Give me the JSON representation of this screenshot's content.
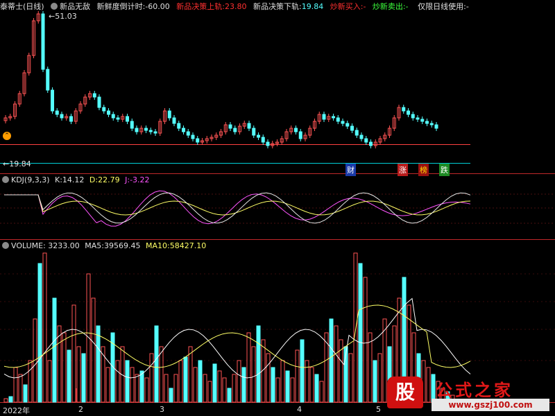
{
  "header": {
    "stock_name": "泰蒂士(日线)",
    "indicator_name": "新品无敌",
    "countdown_label": "新鲜度倒计时:",
    "countdown_value": "-60.00",
    "upper_label": "新品决策上轨:",
    "upper_value": "23.80",
    "lower_label": "新品决策下轨:",
    "lower_value": "19.84",
    "buy_label": "炒新买入:",
    "buy_value": "-",
    "sell_label": "炒新卖出:",
    "sell_value": "-",
    "daily_only_label": "仅限日线使用:",
    "daily_only_value": "-"
  },
  "price_panel": {
    "high_label": "51.03",
    "low_label": "19.84",
    "tags": {
      "cai": "财",
      "zhang": "涨",
      "bang": "榜",
      "die": "跌"
    }
  },
  "kdj_panel": {
    "title": "KDJ(9,3,3)",
    "k_label": "K:",
    "k_value": "14.12",
    "d_label": "D:",
    "d_value": "22.79",
    "j_label": "J:",
    "j_value": "-3.22"
  },
  "volume_panel": {
    "title": "VOLUME:",
    "volume_value": "3233.00",
    "ma5_label": "MA5:",
    "ma5_value": "39569.45",
    "ma10_label": "MA10:",
    "ma10_value": "58427.10"
  },
  "x_axis": [
    "2022年",
    "2",
    "3",
    "4",
    "5"
  ],
  "watermark": {
    "badge": "股",
    "title": "公式之家",
    "url": "www.gszj100.com"
  },
  "colors": {
    "up": "#ff5454",
    "down": "#54ffff",
    "kline": "#e8e8e8",
    "dline": "#ffff66",
    "jline": "#ff55ff",
    "cyan": "#00d0d8",
    "grid": "#c0282a"
  },
  "chart_data": {
    "type": "bar",
    "series_kind": "candlestick + volume",
    "price_high": 51.03,
    "price_low": 19.84,
    "upper_track": 23.8,
    "lower_track": 19.84,
    "kdj": {
      "k": 14.12,
      "d": 22.79,
      "j": -3.22
    },
    "volume": {
      "last": 3233.0,
      "ma5": 39569.45,
      "ma10": 58427.1
    }
  }
}
